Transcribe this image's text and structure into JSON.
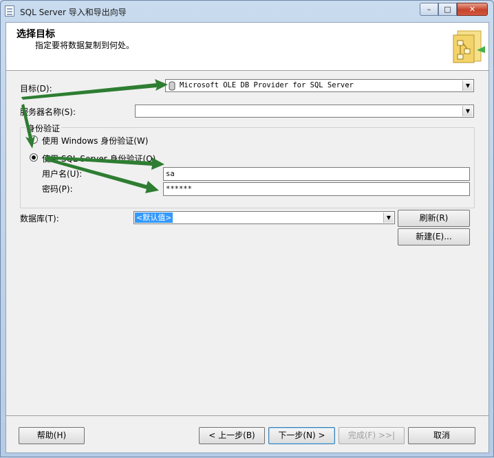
{
  "window": {
    "title": "SQL Server 导入和导出向导",
    "minimize_glyph": "–",
    "maximize_glyph": "□",
    "close_glyph": "✕"
  },
  "header": {
    "title": "选择目标",
    "subtitle": "指定要将数据复制到何处。"
  },
  "form": {
    "destination_label": "目标(D):",
    "destination_value": "Microsoft OLE DB Provider for SQL Server",
    "server_label": "服务器名称(S):",
    "server_value": "",
    "auth_group_label": "身份验证",
    "auth_windows_label": "使用 Windows 身份验证(W)",
    "auth_sql_label": "使用 SQL Server 身份验证(Q)",
    "auth_selected": "sql",
    "username_label": "用户名(U):",
    "username_value": "sa",
    "password_label": "密码(P):",
    "password_value": "******",
    "database_label": "数据库(T):",
    "database_value": "<默认值>",
    "refresh_label": "刷新(R)",
    "new_label": "新建(E)..."
  },
  "footer": {
    "help_label": "帮助(H)",
    "back_label": "< 上一步(B)",
    "next_label": "下一步(N) >",
    "finish_label": "完成(F) >>|",
    "cancel_label": "取消"
  },
  "icons": {
    "app": "wizard-document-icon",
    "destination_provider": "database-cylinder-icon",
    "wizard_graphic": "folder-flow-icon"
  },
  "colors": {
    "annotation_arrow": "#2e7d32",
    "selection_highlight": "#3399ff",
    "title_close": "#c6432b"
  }
}
